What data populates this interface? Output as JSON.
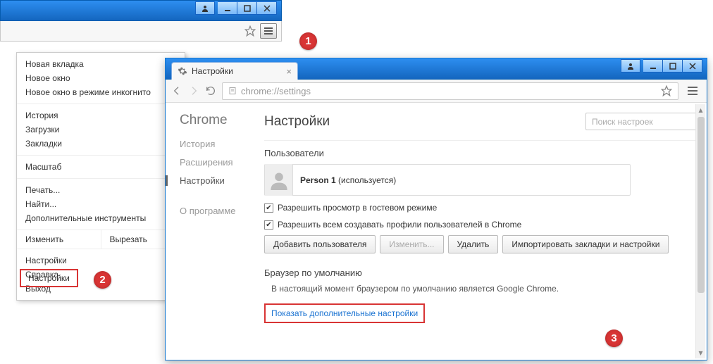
{
  "menu": {
    "groups": [
      [
        "Новая вкладка",
        "Новое окно",
        "Новое окно в режиме инкогнито"
      ],
      [
        "История",
        "Загрузки",
        "Закладки"
      ],
      [
        "Масштаб"
      ],
      [
        "Печать...",
        "Найти...",
        "Дополнительные инструменты"
      ]
    ],
    "row": [
      "Изменить",
      "Вырезать"
    ],
    "tail": [
      "Настройки",
      "Справка",
      "Выход"
    ]
  },
  "w2": {
    "tab_label": "Настройки",
    "url": "chrome://settings",
    "sidebar": {
      "title": "Chrome",
      "items": [
        "История",
        "Расширения",
        "Настройки",
        "О программе"
      ],
      "active_idx": 2
    },
    "page_title": "Настройки",
    "search_placeholder": "Поиск настроек",
    "sect_users": "Пользователи",
    "person_name": "Person 1",
    "person_use": " (используется)",
    "chk1": "Разрешить просмотр в гостевом режиме",
    "chk2": "Разрешить всем создавать профили пользователей в Chrome",
    "btn_add": "Добавить пользователя",
    "btn_edit": "Изменить...",
    "btn_del": "Удалить",
    "btn_import": "Импортировать закладки и настройки",
    "sect_default": "Браузер по умолчанию",
    "default_text": "В настоящий момент браузером по умолчанию является Google Chrome.",
    "show_more": "Показать дополнительные настройки"
  },
  "callouts": {
    "c1": "1",
    "c2": "2",
    "c3": "3"
  }
}
